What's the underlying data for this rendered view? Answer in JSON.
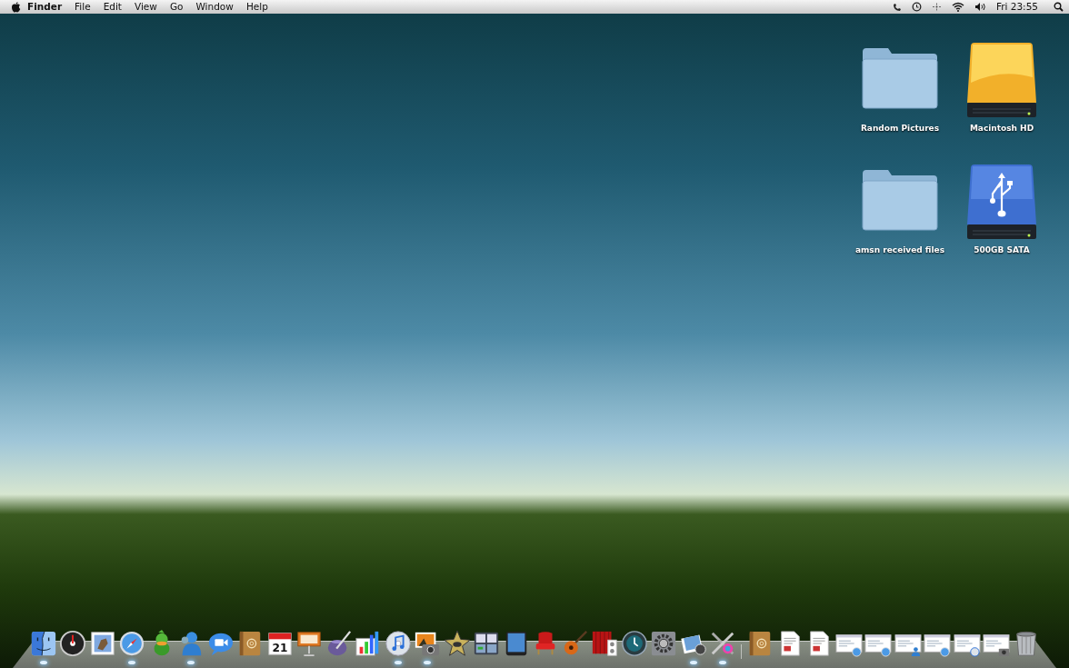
{
  "menu_bar": {
    "menus": [
      {
        "label": "Finder",
        "kind": "app"
      },
      {
        "label": "File",
        "kind": "menu"
      },
      {
        "label": "Edit",
        "kind": "menu"
      },
      {
        "label": "View",
        "kind": "menu"
      },
      {
        "label": "Go",
        "kind": "menu"
      },
      {
        "label": "Window",
        "kind": "menu"
      },
      {
        "label": "Help",
        "kind": "menu"
      }
    ],
    "clock": "Fri 23:55"
  },
  "desktop_icons": [
    {
      "label": "Random Pictures",
      "kind": "folder"
    },
    {
      "label": "Macintosh HD",
      "kind": "drive"
    },
    {
      "label": "amsn received files",
      "kind": "folder"
    },
    {
      "label": "500GB SATA",
      "kind": "usb-drive"
    }
  ],
  "dock": {
    "items": [
      {
        "kind": "finder",
        "running": true
      },
      {
        "kind": "dashboard",
        "running": false
      },
      {
        "kind": "mail",
        "running": false
      },
      {
        "kind": "safari",
        "running": true
      },
      {
        "kind": "adium",
        "running": false
      },
      {
        "kind": "messenger",
        "running": true
      },
      {
        "kind": "ichat",
        "running": false
      },
      {
        "kind": "addressbook",
        "running": false
      },
      {
        "kind": "calendar",
        "running": false,
        "text": "21"
      },
      {
        "kind": "keynote",
        "running": false
      },
      {
        "kind": "pen",
        "running": false
      },
      {
        "kind": "chart",
        "running": false
      },
      {
        "kind": "music",
        "running": true
      },
      {
        "kind": "photo",
        "running": true
      },
      {
        "kind": "star",
        "running": false
      },
      {
        "kind": "spaces",
        "running": false
      },
      {
        "kind": "tablet",
        "running": false
      },
      {
        "kind": "chair",
        "running": false
      },
      {
        "kind": "guitar",
        "running": false
      },
      {
        "kind": "curtain",
        "running": false
      },
      {
        "kind": "timeclock",
        "running": false
      },
      {
        "kind": "gear",
        "running": false
      },
      {
        "kind": "photos",
        "running": true
      },
      {
        "kind": "tools",
        "running": true
      },
      {
        "kind": "separator",
        "running": false
      },
      {
        "kind": "addressbook",
        "running": false
      },
      {
        "kind": "document",
        "running": false
      },
      {
        "kind": "document",
        "running": false
      },
      {
        "kind": "window-safari",
        "running": false
      },
      {
        "kind": "window-safari",
        "running": false
      },
      {
        "kind": "window-messenger",
        "running": false
      },
      {
        "kind": "window-safari",
        "running": false
      },
      {
        "kind": "window-music",
        "running": false
      },
      {
        "kind": "window-photo",
        "running": false
      },
      {
        "kind": "trash",
        "running": false
      }
    ]
  }
}
